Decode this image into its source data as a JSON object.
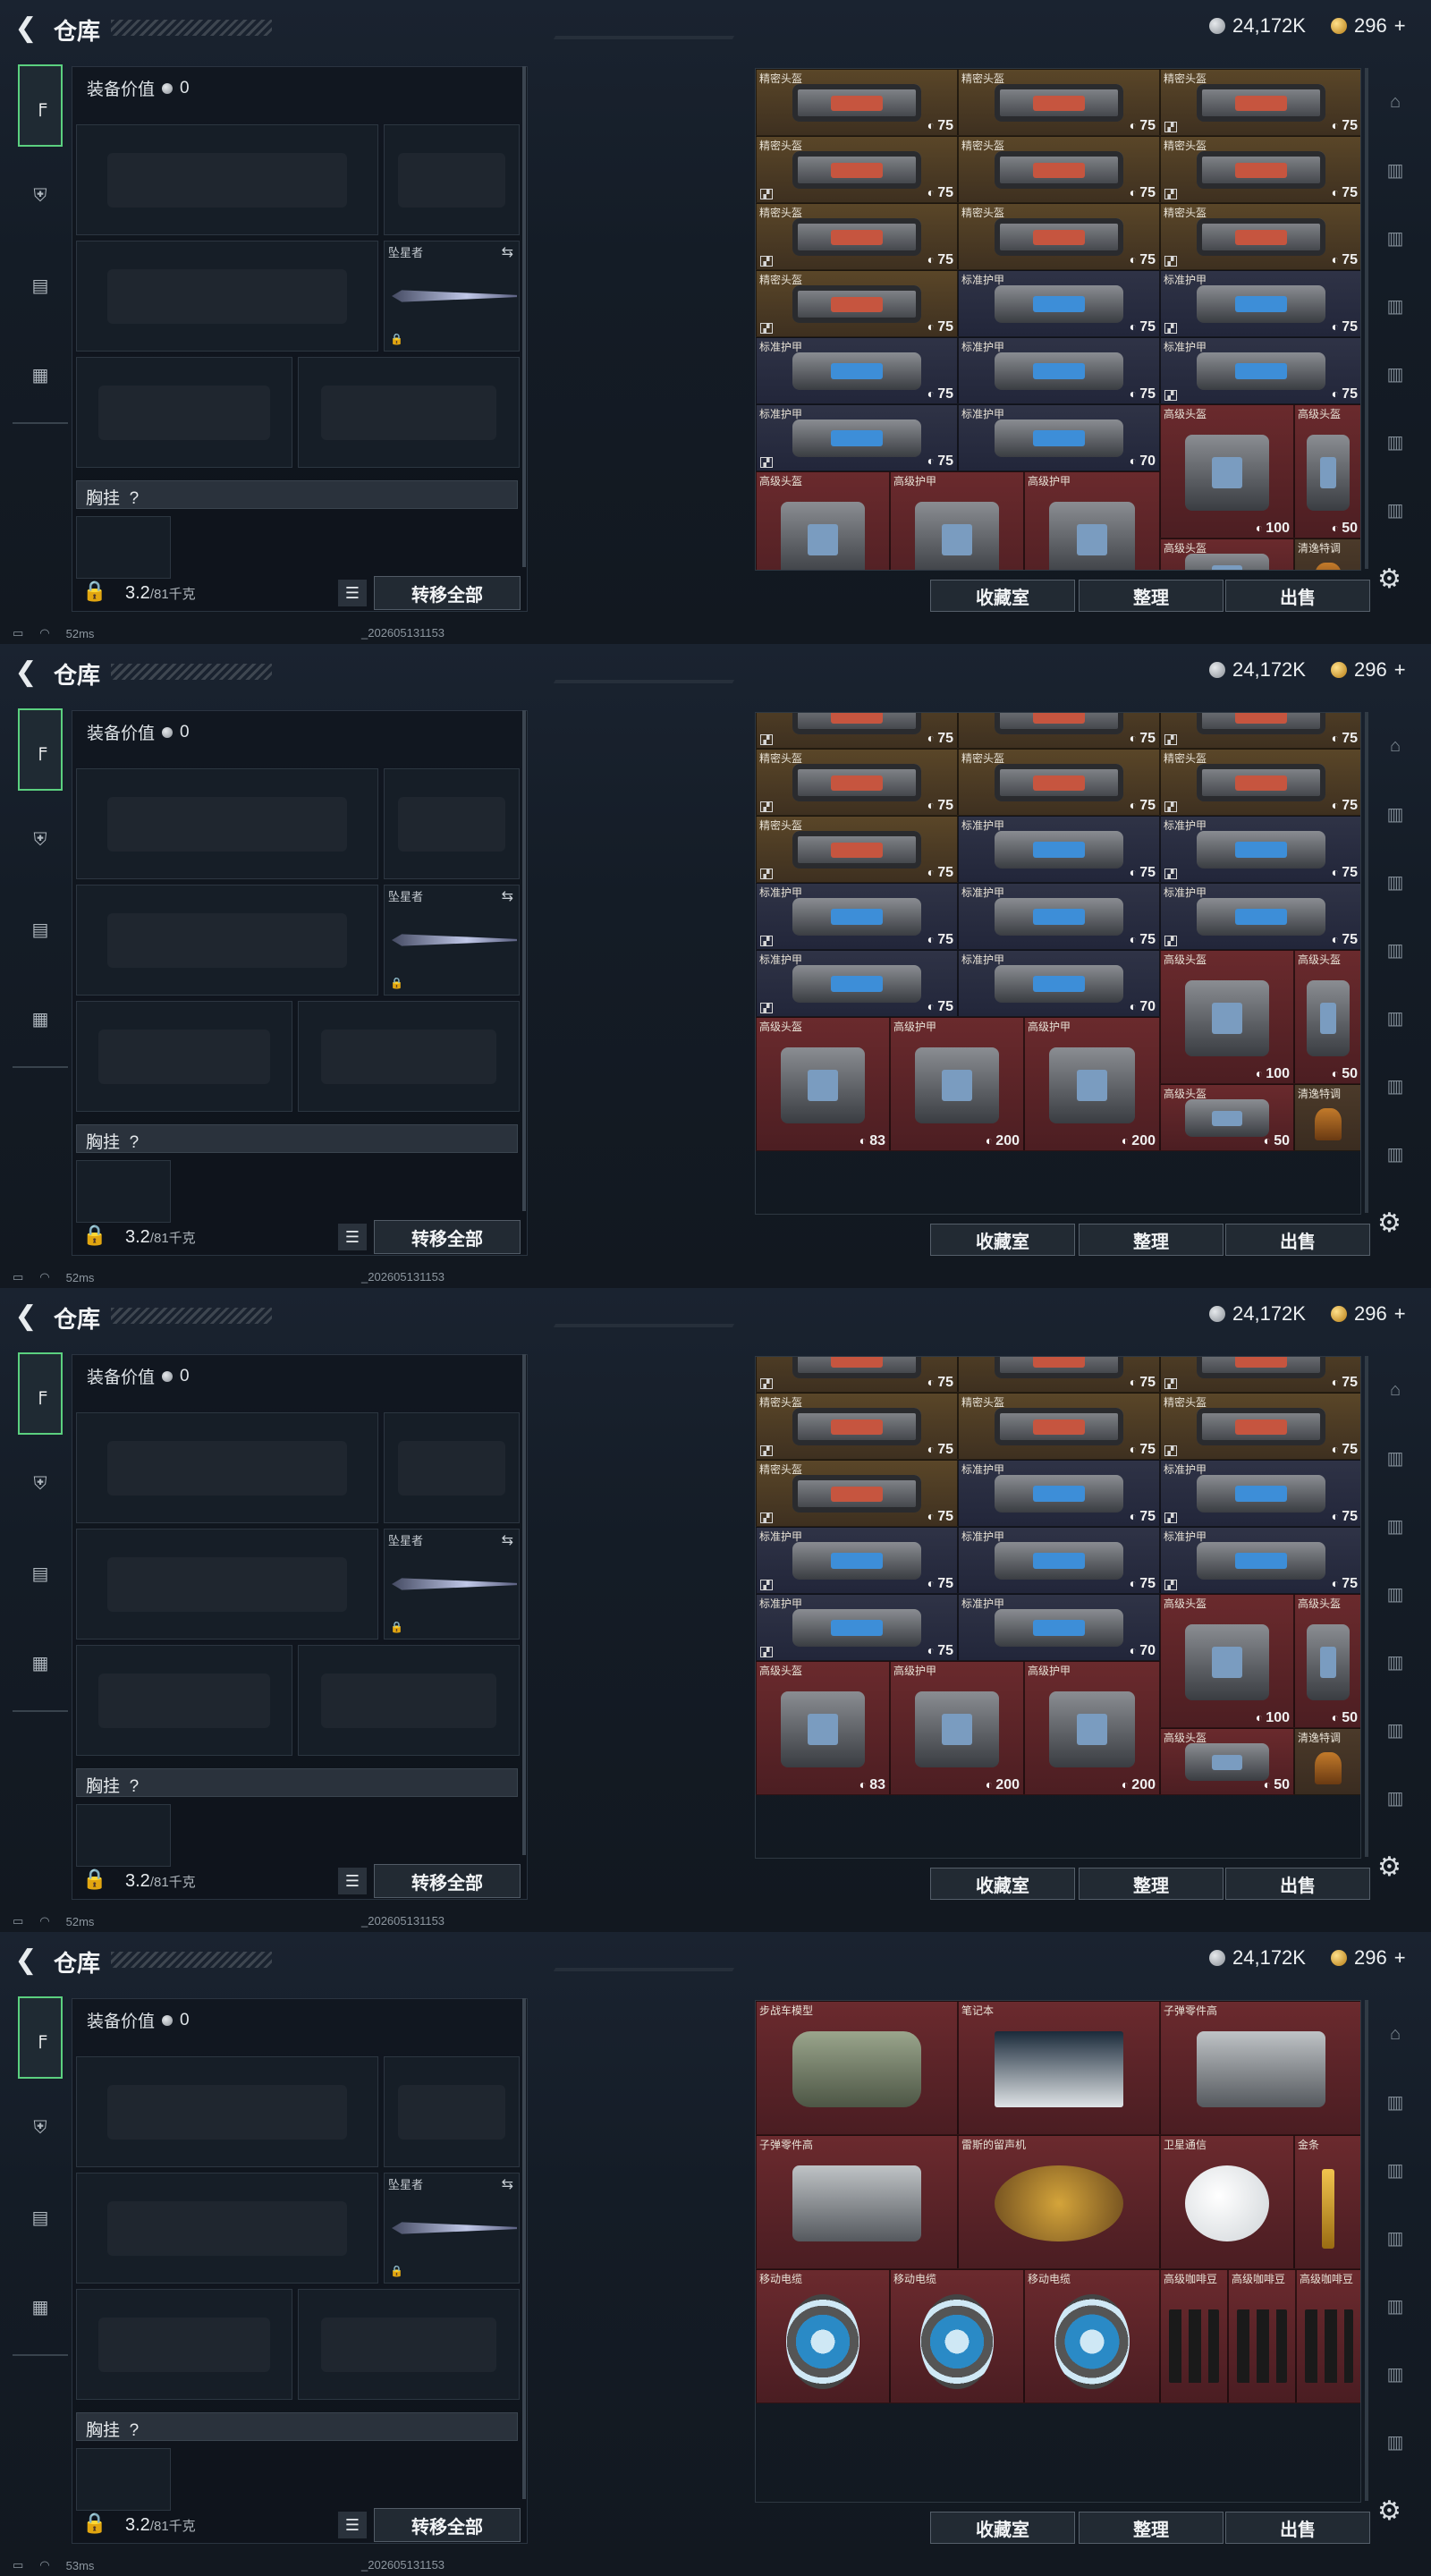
{
  "page": {
    "title": "仓库"
  },
  "currency": {
    "silver": "24,172K",
    "gold": "296",
    "gold_plus": "+"
  },
  "loadout": {
    "value_label": "装备价值",
    "value": "0",
    "knife_name": "坠星者",
    "rig_label": "胸挂",
    "rig_help": "?"
  },
  "weight": {
    "current": "3.2",
    "max": "/81千克"
  },
  "buttons": {
    "transfer_all": "转移全部",
    "collection": "收藏室",
    "sort": "整理",
    "sell": "出售"
  },
  "status": {
    "ping1": "52ms",
    "ping2": "52ms",
    "ping3": "52ms",
    "ping4": "53ms",
    "build": "_202605131153"
  },
  "grid_frames": [
    {
      "cells": [
        {
          "name": "精密头盔",
          "type": "helm",
          "dur": "75",
          "tag": ""
        },
        {
          "name": "精密头盔",
          "type": "helm",
          "dur": "75",
          "tag": ""
        },
        {
          "name": "精密头盔",
          "type": "helm",
          "dur": "75",
          "tag": "⛝"
        },
        {
          "name": "精密头盔",
          "type": "helm",
          "dur": "75",
          "tag": "⛝"
        },
        {
          "name": "精密头盔",
          "type": "helm",
          "dur": "75",
          "tag": ""
        },
        {
          "name": "精密头盔",
          "type": "helm",
          "dur": "75",
          "tag": "⛝"
        },
        {
          "name": "精密头盔",
          "type": "helm",
          "dur": "75",
          "tag": "⛝"
        },
        {
          "name": "精密头盔",
          "type": "helm",
          "dur": "75",
          "tag": "⛝"
        },
        {
          "name": "精密头盔",
          "type": "helm",
          "dur": "75",
          "tag": "⛝"
        },
        {
          "name": "精密头盔",
          "type": "helm",
          "dur": "75",
          "tag": "⛝"
        },
        {
          "name": "标准护甲",
          "type": "armor",
          "dur": "75",
          "tag": ""
        },
        {
          "name": "标准护甲",
          "type": "armor",
          "dur": "75",
          "tag": ""
        },
        {
          "name": "标准护甲",
          "type": "armor",
          "dur": "75",
          "tag": ""
        },
        {
          "name": "标准护甲",
          "type": "armor",
          "dur": "75",
          "tag": ""
        },
        {
          "name": "标准护甲",
          "type": "armor",
          "dur": "75",
          "tag": "⛝"
        },
        {
          "name": "标准护甲",
          "type": "armor",
          "dur": "75",
          "tag": "⛝"
        },
        {
          "name": "标准护甲",
          "type": "armor",
          "dur": "70",
          "tag": ""
        }
      ]
    }
  ],
  "grid_names": {
    "precision_helmet": "精密头盔",
    "standard_armor": "标准护甲",
    "advanced_helmet": "高级头盔",
    "advanced_armor": "高级护甲",
    "drink": "清逸特调",
    "tank_model": "步战车模型",
    "laptop": "笔记本",
    "bullet_parts": "子弹零件高",
    "bullet_parts2": "子弹零件高",
    "gramophone": "雷斯的留声机",
    "satellite": "卫星通信",
    "gold_bar": "金条",
    "reel": "移动电缆",
    "coffee": "高级咖啡豆"
  },
  "dur": {
    "d75": "75",
    "d70": "70",
    "d100": "100",
    "d50": "50",
    "d83": "83",
    "d200": "200"
  }
}
